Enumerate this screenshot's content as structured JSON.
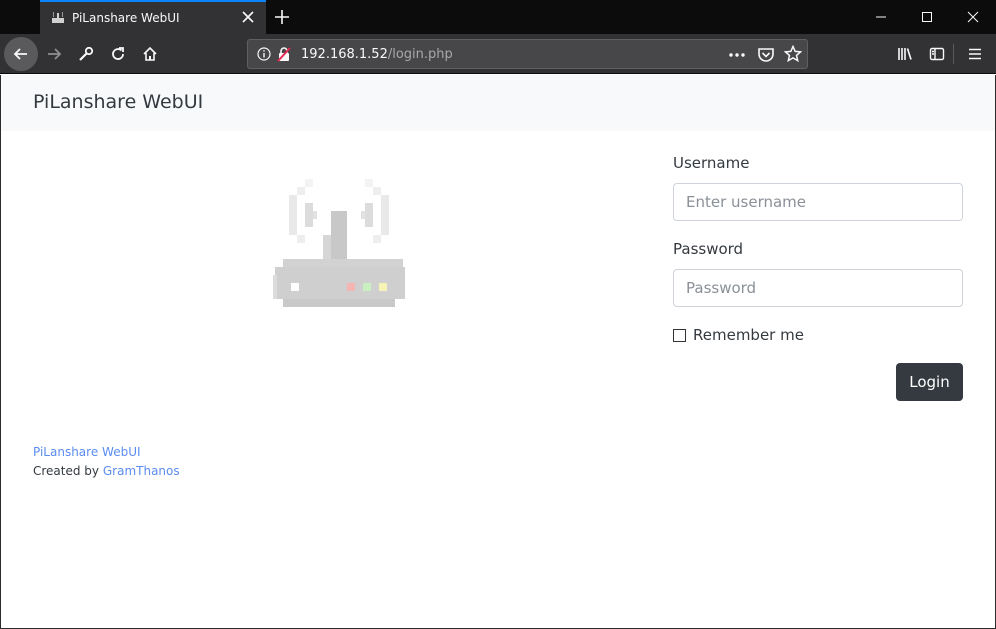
{
  "browser": {
    "tab": {
      "title": "PiLanshare WebUI"
    },
    "urlbar": {
      "host": "192.168.1.52",
      "path": "/login.php"
    }
  },
  "header": {
    "brand": "PiLanshare WebUI"
  },
  "login_form": {
    "username_label": "Username",
    "username_placeholder": "Enter username",
    "password_label": "Password",
    "password_placeholder": "Password",
    "remember_label": "Remember me",
    "remember_checked": false,
    "submit_label": "Login"
  },
  "footer": {
    "project_link": "PiLanshare WebUI",
    "created_by": "Created by",
    "author_link": "GramThanos"
  },
  "colors": {
    "header_bg": "#f8f9fa",
    "button_bg": "#343a40",
    "link": "#5b8def",
    "browser_accent": "#0a84ff"
  },
  "icons": [
    "router-logo-icon",
    "back-arrow-icon",
    "forward-arrow-icon",
    "wrench-icon",
    "reload-icon",
    "home-icon",
    "info-icon",
    "insecure-lock-icon",
    "more-icon",
    "pocket-icon",
    "star-icon",
    "library-icon",
    "sidebar-icon",
    "hamburger-menu-icon",
    "close-icon",
    "plus-icon",
    "minimize-icon",
    "maximize-icon"
  ]
}
